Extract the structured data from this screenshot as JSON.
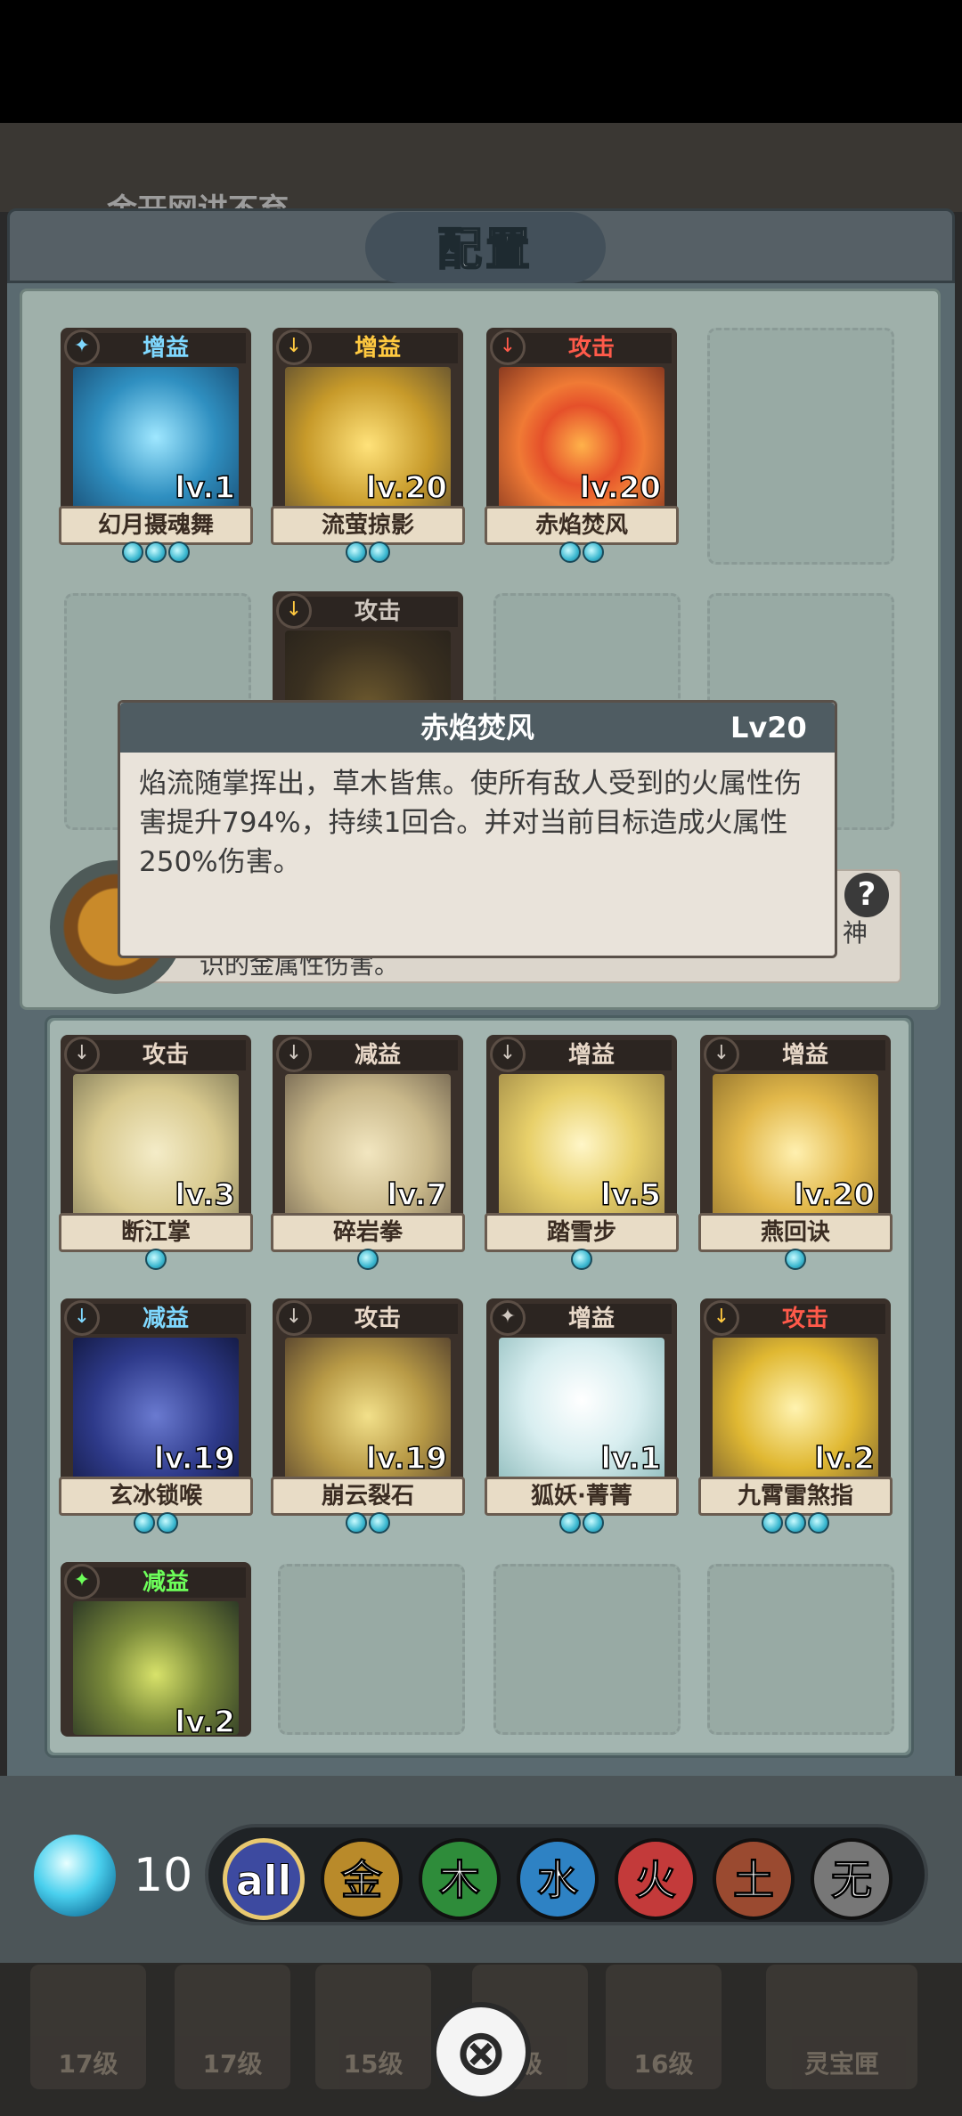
{
  "background": {
    "title": "金开网讲不弃",
    "bottom_items": [
      {
        "label": "17级"
      },
      {
        "label": "17级"
      },
      {
        "label": "15级"
      },
      {
        "label": "级"
      },
      {
        "label": "16级"
      },
      {
        "label": "灵宝匣"
      }
    ]
  },
  "dialog": {
    "title": "配置"
  },
  "equipped": [
    {
      "tag": "增益",
      "name": "幻月摄魂舞",
      "level": "lv.1",
      "stars": 3
    },
    {
      "tag": "增益",
      "name": "流萤掠影",
      "level": "lv.20",
      "stars": 2
    },
    {
      "tag": "攻击",
      "name": "赤焰焚风",
      "level": "lv.20",
      "stars": 2
    },
    {
      "tag": "攻击"
    }
  ],
  "tooltip": {
    "title": "赤焰焚风",
    "level": "Lv20",
    "description": "焰流随掌挥出，草木皆焦。使所有敌人受到的火属性伤害提升794%，持续1回合。并对当前目标造成火属性250%伤害。"
  },
  "passive": {
    "text_visible": "识的金属性伤害。",
    "text_right": "神",
    "help_label": "?"
  },
  "inventory": [
    {
      "tag": "攻击",
      "name": "断江掌",
      "level": "lv.3",
      "stars": 1
    },
    {
      "tag": "减益",
      "name": "碎岩拳",
      "level": "lv.7",
      "stars": 1
    },
    {
      "tag": "增益",
      "name": "踏雪步",
      "level": "lv.5",
      "stars": 1
    },
    {
      "tag": "增益",
      "name": "燕回诀",
      "level": "lv.20",
      "stars": 1
    },
    {
      "tag": "减益",
      "name": "玄冰锁喉",
      "level": "lv.19",
      "stars": 2
    },
    {
      "tag": "攻击",
      "name": "崩云裂石",
      "level": "lv.19",
      "stars": 2
    },
    {
      "tag": "增益",
      "name": "狐妖·菁菁",
      "level": "lv.1",
      "stars": 2
    },
    {
      "tag": "攻击",
      "name": "九霄雷煞指",
      "level": "lv.2",
      "stars": 3
    },
    {
      "tag": "减益",
      "name": "",
      "level": "lv.2",
      "stars": 0
    }
  ],
  "energy": {
    "count": "10"
  },
  "filters": [
    {
      "label": "all",
      "color": "#3d4aa0"
    },
    {
      "label": "金",
      "color": "#b98a2a"
    },
    {
      "label": "木",
      "color": "#2e8c3a"
    },
    {
      "label": "水",
      "color": "#2e82c4"
    },
    {
      "label": "火",
      "color": "#c33a3a"
    },
    {
      "label": "土",
      "color": "#9a4a30"
    },
    {
      "label": "无",
      "color": "#777777"
    }
  ],
  "close_label": "⊗"
}
